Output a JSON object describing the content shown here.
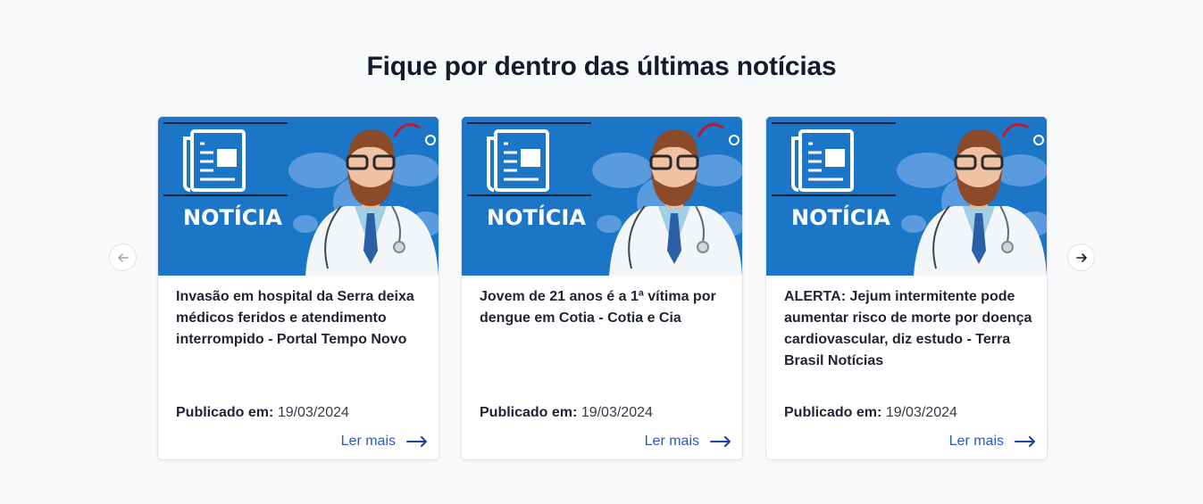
{
  "section": {
    "title": "Fique por dentro das últimas notícias"
  },
  "thumbnail": {
    "label": "NOTÍCIA",
    "bg_color": "#1b76c8"
  },
  "cards": [
    {
      "title": "Invasão em hospital da Serra deixa médicos feridos e atendimento interrompido - Portal Tempo Novo",
      "published_label": "Publicado em:",
      "published_date": "19/03/2024",
      "read_more": "Ler mais"
    },
    {
      "title": "Jovem de 21 anos é a 1ª vítima por dengue em Cotia - Cotia e Cia",
      "published_label": "Publicado em:",
      "published_date": "19/03/2024",
      "read_more": "Ler mais"
    },
    {
      "title": "ALERTA: Jejum intermitente pode aumentar risco de morte por doença cardiovascular, diz estudo - Terra Brasil Notícias",
      "published_label": "Publicado em:",
      "published_date": "19/03/2024",
      "read_more": "Ler mais"
    }
  ],
  "navigation": {
    "prev_icon": "arrow-left-icon",
    "next_icon": "arrow-right-icon"
  },
  "colors": {
    "accent": "#2a58c7",
    "heading": "#141b2d",
    "background": "#f8f9fb"
  }
}
